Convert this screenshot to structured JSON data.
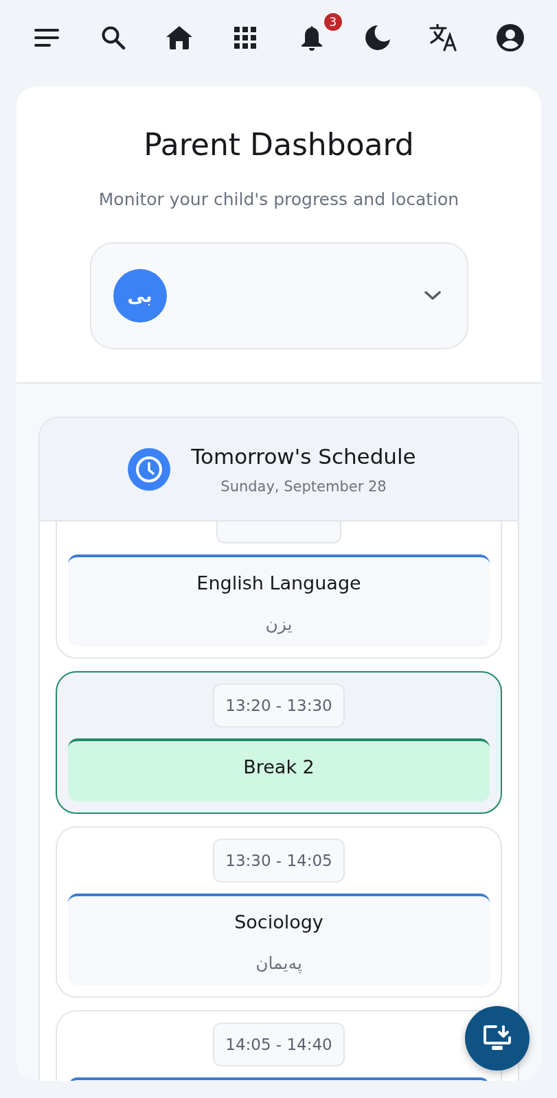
{
  "toolbar": {
    "notification_count": "3"
  },
  "header": {
    "title": "Parent Dashboard",
    "subtitle": "Monitor your child's progress and location"
  },
  "child_selector": {
    "avatar_initials": "بی"
  },
  "schedule": {
    "title": "Tomorrow's Schedule",
    "date": "Sunday, September 28",
    "items": [
      {
        "kind": "class",
        "subject": "English Language",
        "teacher": "یزن"
      },
      {
        "kind": "break",
        "time": "13:20 - 13:30",
        "subject": "Break 2"
      },
      {
        "kind": "class",
        "time": "13:30 - 14:05",
        "subject": "Sociology",
        "teacher": "پەیمان"
      },
      {
        "kind": "class",
        "time": "14:05 - 14:40"
      }
    ]
  }
}
